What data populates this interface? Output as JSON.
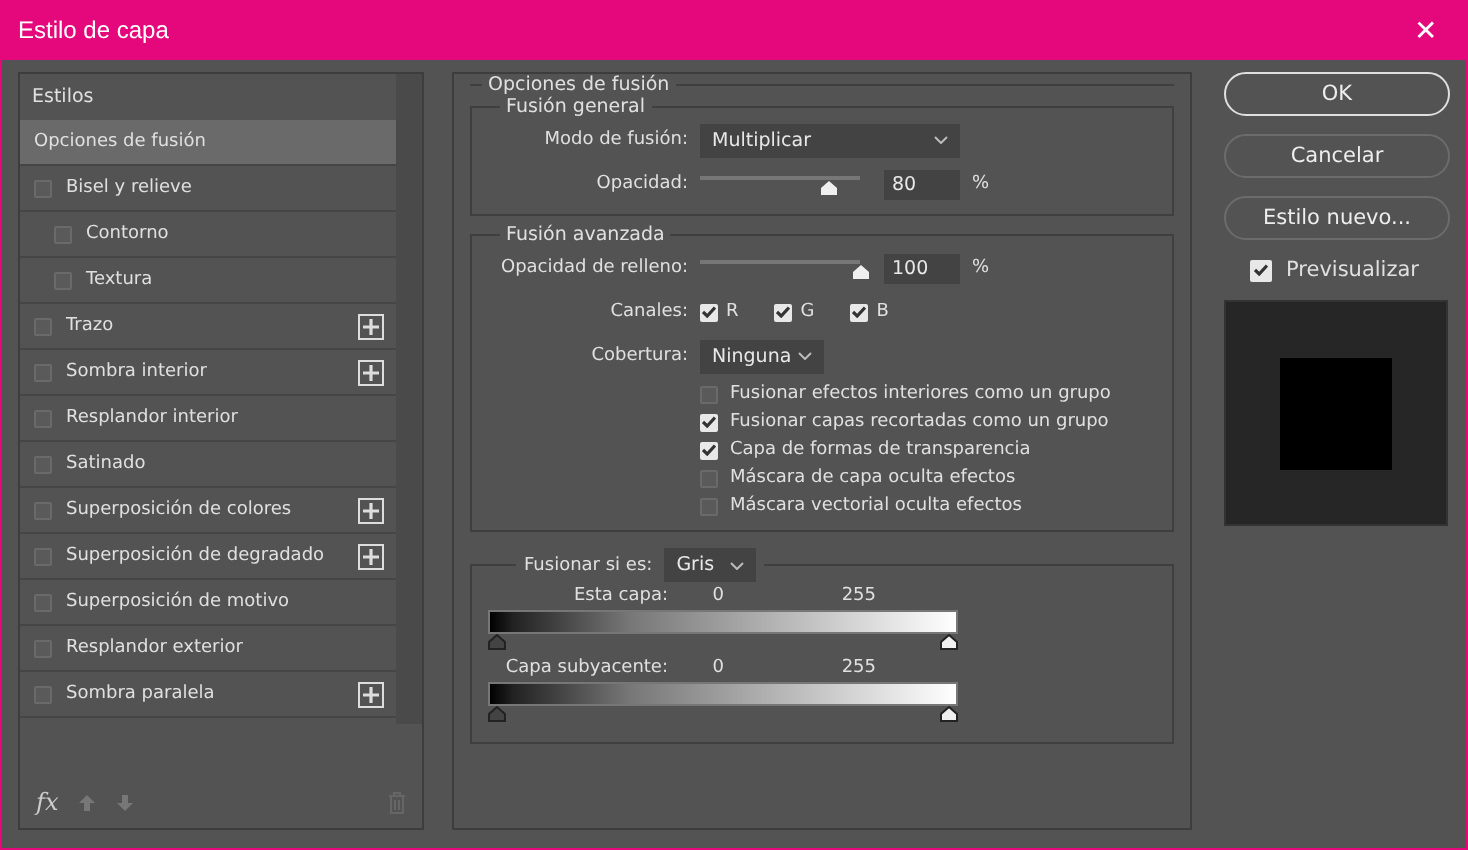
{
  "window": {
    "title": "Estilo de capa",
    "close": "✕"
  },
  "styles": {
    "header": "Estilos",
    "items": [
      {
        "kind": "option",
        "label": "Opciones de fusión",
        "selected": true
      },
      {
        "kind": "effect",
        "label": "Bisel y relieve",
        "checked": false,
        "selected": false,
        "addable": false,
        "children": [
          {
            "kind": "effect",
            "label": "Contorno",
            "checked": false,
            "selected": false,
            "addable": false
          },
          {
            "kind": "effect",
            "label": "Textura",
            "checked": false,
            "selected": false,
            "addable": false
          }
        ]
      },
      {
        "kind": "effect",
        "label": "Trazo",
        "checked": false,
        "selected": false,
        "addable": true
      },
      {
        "kind": "effect",
        "label": "Sombra interior",
        "checked": false,
        "selected": false,
        "addable": true
      },
      {
        "kind": "effect",
        "label": "Resplandor interior",
        "checked": false,
        "selected": false,
        "addable": false
      },
      {
        "kind": "effect",
        "label": "Satinado",
        "checked": false,
        "selected": false,
        "addable": false
      },
      {
        "kind": "effect",
        "label": "Superposición de colores",
        "checked": false,
        "selected": false,
        "addable": true
      },
      {
        "kind": "effect",
        "label": "Superposición de degradado",
        "checked": false,
        "selected": false,
        "addable": true
      },
      {
        "kind": "effect",
        "label": "Superposición de motivo",
        "checked": false,
        "selected": false,
        "addable": false
      },
      {
        "kind": "effect",
        "label": "Resplandor exterior",
        "checked": false,
        "selected": false,
        "addable": false
      },
      {
        "kind": "effect",
        "label": "Sombra paralela",
        "checked": false,
        "selected": false,
        "addable": true
      }
    ],
    "fx": "fx"
  },
  "blending": {
    "title": "Opciones de fusión",
    "general": {
      "title": "Fusión general",
      "mode_label": "Modo de fusión:",
      "mode": "Multiplicar",
      "opacity_label": "Opacidad:",
      "opacity": {
        "level": 0.8,
        "value": "80",
        "unit": "%"
      }
    },
    "advanced": {
      "title": "Fusión avanzada",
      "fill_label": "Opacidad de relleno:",
      "fill": {
        "level": 1,
        "value": "100",
        "unit": "%"
      },
      "channels_label": "Canales:",
      "channels": [
        {
          "label": "R",
          "checked": true
        },
        {
          "label": "G",
          "checked": true
        },
        {
          "label": "B",
          "checked": true
        }
      ],
      "knockout_label": "Cobertura:",
      "knockout": "Ninguna",
      "options": [
        {
          "label": "Fusionar efectos interiores como un grupo",
          "checked": false
        },
        {
          "label": "Fusionar capas recortadas como un grupo",
          "checked": true
        },
        {
          "label": "Capa de formas de transparencia",
          "checked": true
        },
        {
          "label": "Máscara de capa oculta efectos",
          "checked": false
        },
        {
          "label": "Máscara vectorial oculta efectos",
          "checked": false
        }
      ]
    },
    "blend_if": {
      "label": "Fusionar si es:",
      "value": "Gris",
      "bars": [
        {
          "label": "Esta capa:",
          "low": "0",
          "high": "255"
        },
        {
          "label": "Capa subyacente:",
          "low": "0",
          "high": "255"
        }
      ]
    }
  },
  "buttons": [
    {
      "label": "OK",
      "default": true
    },
    {
      "label": "Cancelar",
      "default": false
    },
    {
      "label": "Estilo nuevo...",
      "default": false
    }
  ],
  "preview": {
    "label": "Previsualizar",
    "checked": true
  }
}
